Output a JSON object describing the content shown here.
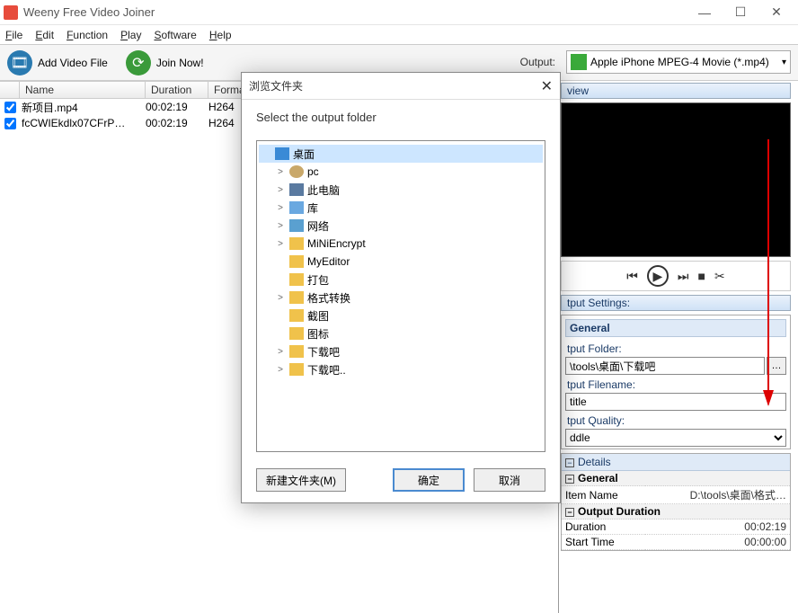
{
  "app": {
    "title": "Weeny Free Video Joiner"
  },
  "window_controls": {
    "min": "—",
    "max": "☐",
    "close": "✕"
  },
  "menu": {
    "file": "File",
    "edit": "Edit",
    "function": "Function",
    "play": "Play",
    "software": "Software",
    "help": "Help"
  },
  "toolbar": {
    "add_video": "Add Video File",
    "join_now": "Join Now!",
    "output_label": "Output:",
    "output_format": "Apple iPhone MPEG-4 Movie (*.mp4)"
  },
  "list": {
    "columns": {
      "name": "Name",
      "duration": "Duration",
      "format": "Format"
    },
    "rows": [
      {
        "checked": true,
        "name": "新项目.mp4",
        "duration": "00:02:19",
        "format": "H264"
      },
      {
        "checked": true,
        "name": "fcCWIEkdlx07CFrP…",
        "duration": "00:02:19",
        "format": "H264"
      }
    ]
  },
  "preview": {
    "header": "view"
  },
  "playback": {
    "prev": "⏮",
    "play": "▶",
    "next": "⏭",
    "stop": "■",
    "cut": "✂"
  },
  "output_settings": {
    "header": "tput Settings:",
    "group_general": "General",
    "folder_label": "tput Folder:",
    "folder_value": "\\tools\\桌面\\下载吧",
    "browse": "…",
    "filename_label": "tput Filename:",
    "filename_value": "title",
    "quality_label": "tput Quality:",
    "quality_value": "ddle"
  },
  "details": {
    "header": "Details",
    "general": "General",
    "item_name_label": "Item Name",
    "item_name_value": "D:\\tools\\桌面\\格式…",
    "output_duration": "Output Duration",
    "duration_label": "Duration",
    "duration_value": "00:02:19",
    "start_label": "Start Time",
    "start_value": "00:00:00"
  },
  "dialog": {
    "title": "浏览文件夹",
    "subtitle": "Select the output folder",
    "tree": [
      {
        "label": "桌面",
        "icon": "desktop",
        "level": 0,
        "expand": "",
        "sel": true
      },
      {
        "label": "pc",
        "icon": "user",
        "level": 1,
        "expand": ">"
      },
      {
        "label": "此电脑",
        "icon": "pc",
        "level": 1,
        "expand": ">"
      },
      {
        "label": "库",
        "icon": "lib",
        "level": 1,
        "expand": ">"
      },
      {
        "label": "网络",
        "icon": "net",
        "level": 1,
        "expand": ">"
      },
      {
        "label": "MiNiEncrypt",
        "icon": "folder",
        "level": 1,
        "expand": ">"
      },
      {
        "label": "MyEditor",
        "icon": "folder",
        "level": 1,
        "expand": ""
      },
      {
        "label": "打包",
        "icon": "folder",
        "level": 1,
        "expand": ""
      },
      {
        "label": "格式转换",
        "icon": "folder",
        "level": 1,
        "expand": ">"
      },
      {
        "label": "截图",
        "icon": "folder",
        "level": 1,
        "expand": ""
      },
      {
        "label": "图标",
        "icon": "folder",
        "level": 1,
        "expand": ""
      },
      {
        "label": "下载吧",
        "icon": "folder",
        "level": 1,
        "expand": ">"
      },
      {
        "label": "下载吧..",
        "icon": "folder",
        "level": 1,
        "expand": ">"
      }
    ],
    "new_folder": "新建文件夹(M)",
    "ok": "确定",
    "cancel": "取消"
  }
}
